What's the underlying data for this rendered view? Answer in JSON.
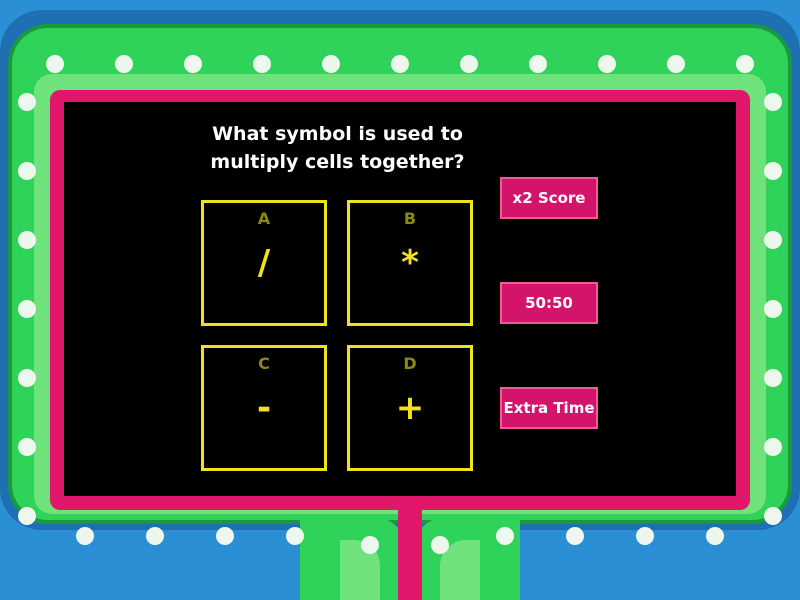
{
  "question": {
    "line1": "What symbol is used to",
    "line2": "multiply cells together?"
  },
  "answers": [
    {
      "letter": "A",
      "value": "/"
    },
    {
      "letter": "B",
      "value": "*"
    },
    {
      "letter": "C",
      "value": "-"
    },
    {
      "letter": "D",
      "value": "+"
    }
  ],
  "powerups": {
    "double_score": "x2 Score",
    "fifty_fifty": "50:50",
    "extra_time": "Extra Time"
  },
  "colors": {
    "answer_border": "#f2e21a",
    "powerup_bg": "#d4146a",
    "frame_pink": "#e0176a",
    "frame_green": "#2fd35a"
  }
}
